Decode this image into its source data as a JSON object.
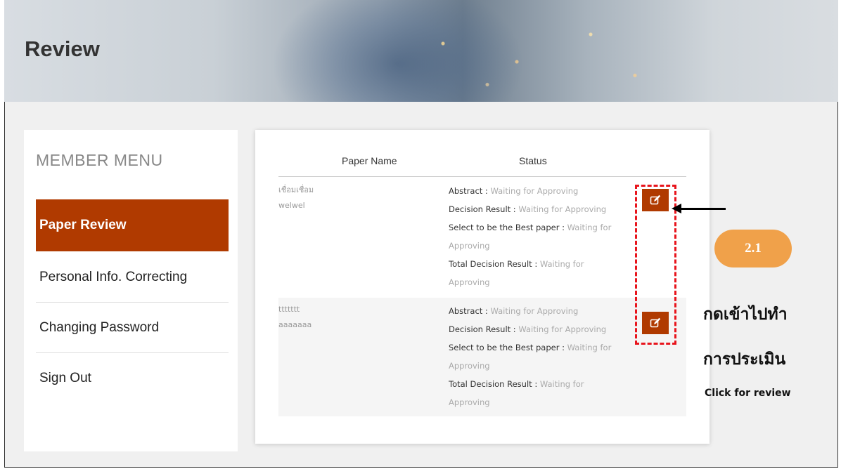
{
  "header": {
    "title": "Review"
  },
  "sidebar": {
    "heading": "MEMBER MENU",
    "items": [
      {
        "label": "Paper Review",
        "active": true
      },
      {
        "label": "Personal Info. Correcting",
        "active": false
      },
      {
        "label": "Changing Password",
        "active": false
      },
      {
        "label": "Sign Out",
        "active": false
      }
    ]
  },
  "table": {
    "columns": [
      "Paper Name",
      "Status"
    ],
    "rows": [
      {
        "name_lines": [
          "เชื่อมเชื่อม",
          "welwel"
        ],
        "status": [
          {
            "label": "Abstract :",
            "value": "Waiting for Approving"
          },
          {
            "label": "Decision Result :",
            "value": "Waiting for Approving"
          },
          {
            "label": "Select to be the Best paper :",
            "value": "Waiting for Approving"
          },
          {
            "label": "Total Decision Result :",
            "value": "Waiting for Approving"
          }
        ]
      },
      {
        "name_lines": [
          "ttttttt",
          "aaaaaaa"
        ],
        "status": [
          {
            "label": "Abstract :",
            "value": "Waiting for Approving"
          },
          {
            "label": "Decision Result :",
            "value": "Waiting for Approving"
          },
          {
            "label": "Select to be the Best paper :",
            "value": "Waiting for Approving"
          },
          {
            "label": "Total Decision Result :",
            "value": "Waiting for Approving"
          }
        ]
      }
    ]
  },
  "annotation": {
    "step": "2.1",
    "thai_lines": [
      "กดเข้าไปทำ",
      "การประเมิน"
    ],
    "english": "Click for review"
  },
  "colors": {
    "accent": "#b03a00",
    "highlight": "#e8141c",
    "badge": "#f0a14a"
  },
  "icons": {
    "edit_button": "edit-icon"
  }
}
